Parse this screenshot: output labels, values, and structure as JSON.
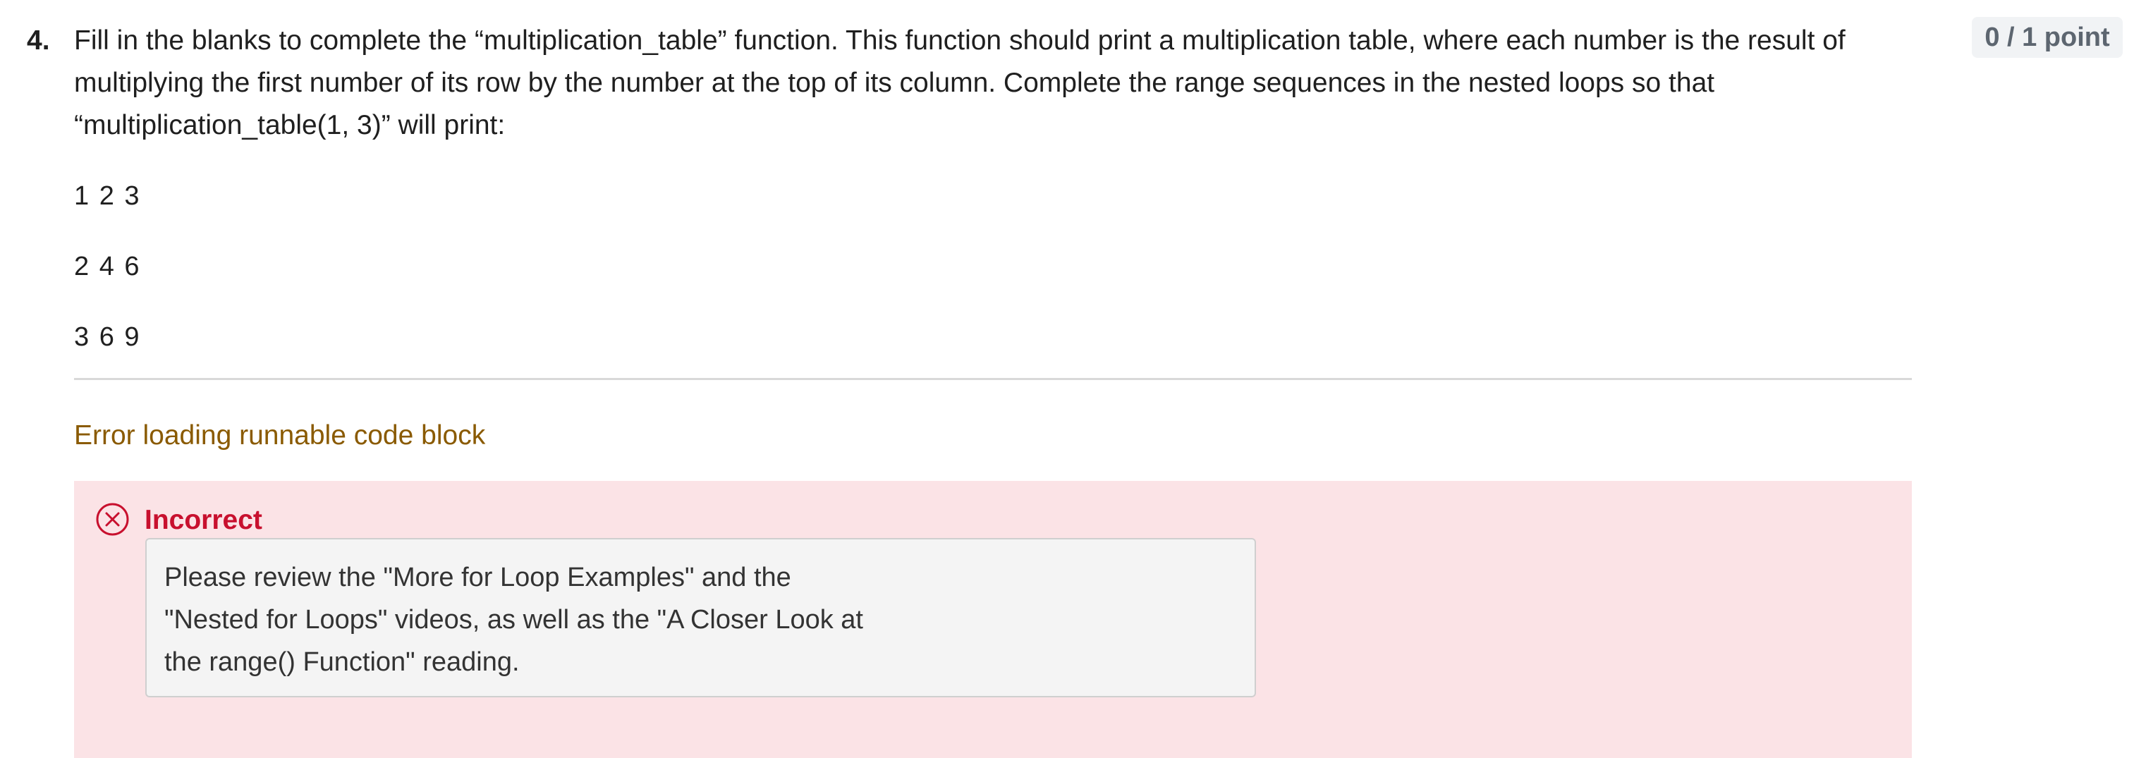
{
  "question": {
    "number": "4.",
    "text": "Fill in the blanks to complete the “multiplication_table” function. This function should print a multiplication table, where each number is the result of multiplying the first number of its row by the number at the top of its column. Complete the range sequences in the nested loops so that “multiplication_table(1, 3)” will print:",
    "expected_output": [
      "1 2 3",
      "2 4 6",
      "3 6 9"
    ]
  },
  "score": {
    "label": "0 / 1 point"
  },
  "code_block": {
    "error_text": "Error loading runnable code block"
  },
  "feedback": {
    "status": "Incorrect",
    "status_color": "#c8102e",
    "icon": "close-circle-icon",
    "message": "Please review the \"More for Loop Examples\" and the \"Nested for Loops\" videos, as well as the \"A Closer Look at the range() Function\" reading.",
    "panel_color": "#fbe3e6"
  }
}
